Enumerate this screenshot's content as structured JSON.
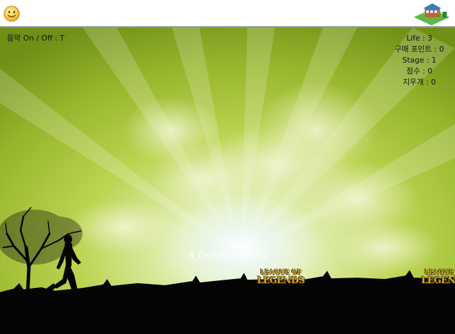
{
  "hud": {
    "music": "음악 On / Off : T",
    "life": "Life : 3",
    "points": "구매 포인트 : 0",
    "stage": "Stage : 1",
    "score": "점수 : 0",
    "erasers": "지우개 : 0"
  },
  "background": {
    "watermark": "A Dreamy World",
    "logo_top": "LEAGUE OF",
    "logo_bottom": "LEGENDS"
  },
  "icons": {
    "smiley": "smiley-face-icon",
    "house": "house-icon"
  },
  "colors": {
    "sky_light": "#eef4c8",
    "sky_mid": "#b7d14a",
    "sky_dark": "#6e8f14",
    "ground": "#050505",
    "logo_gold": "#d4a62a"
  }
}
